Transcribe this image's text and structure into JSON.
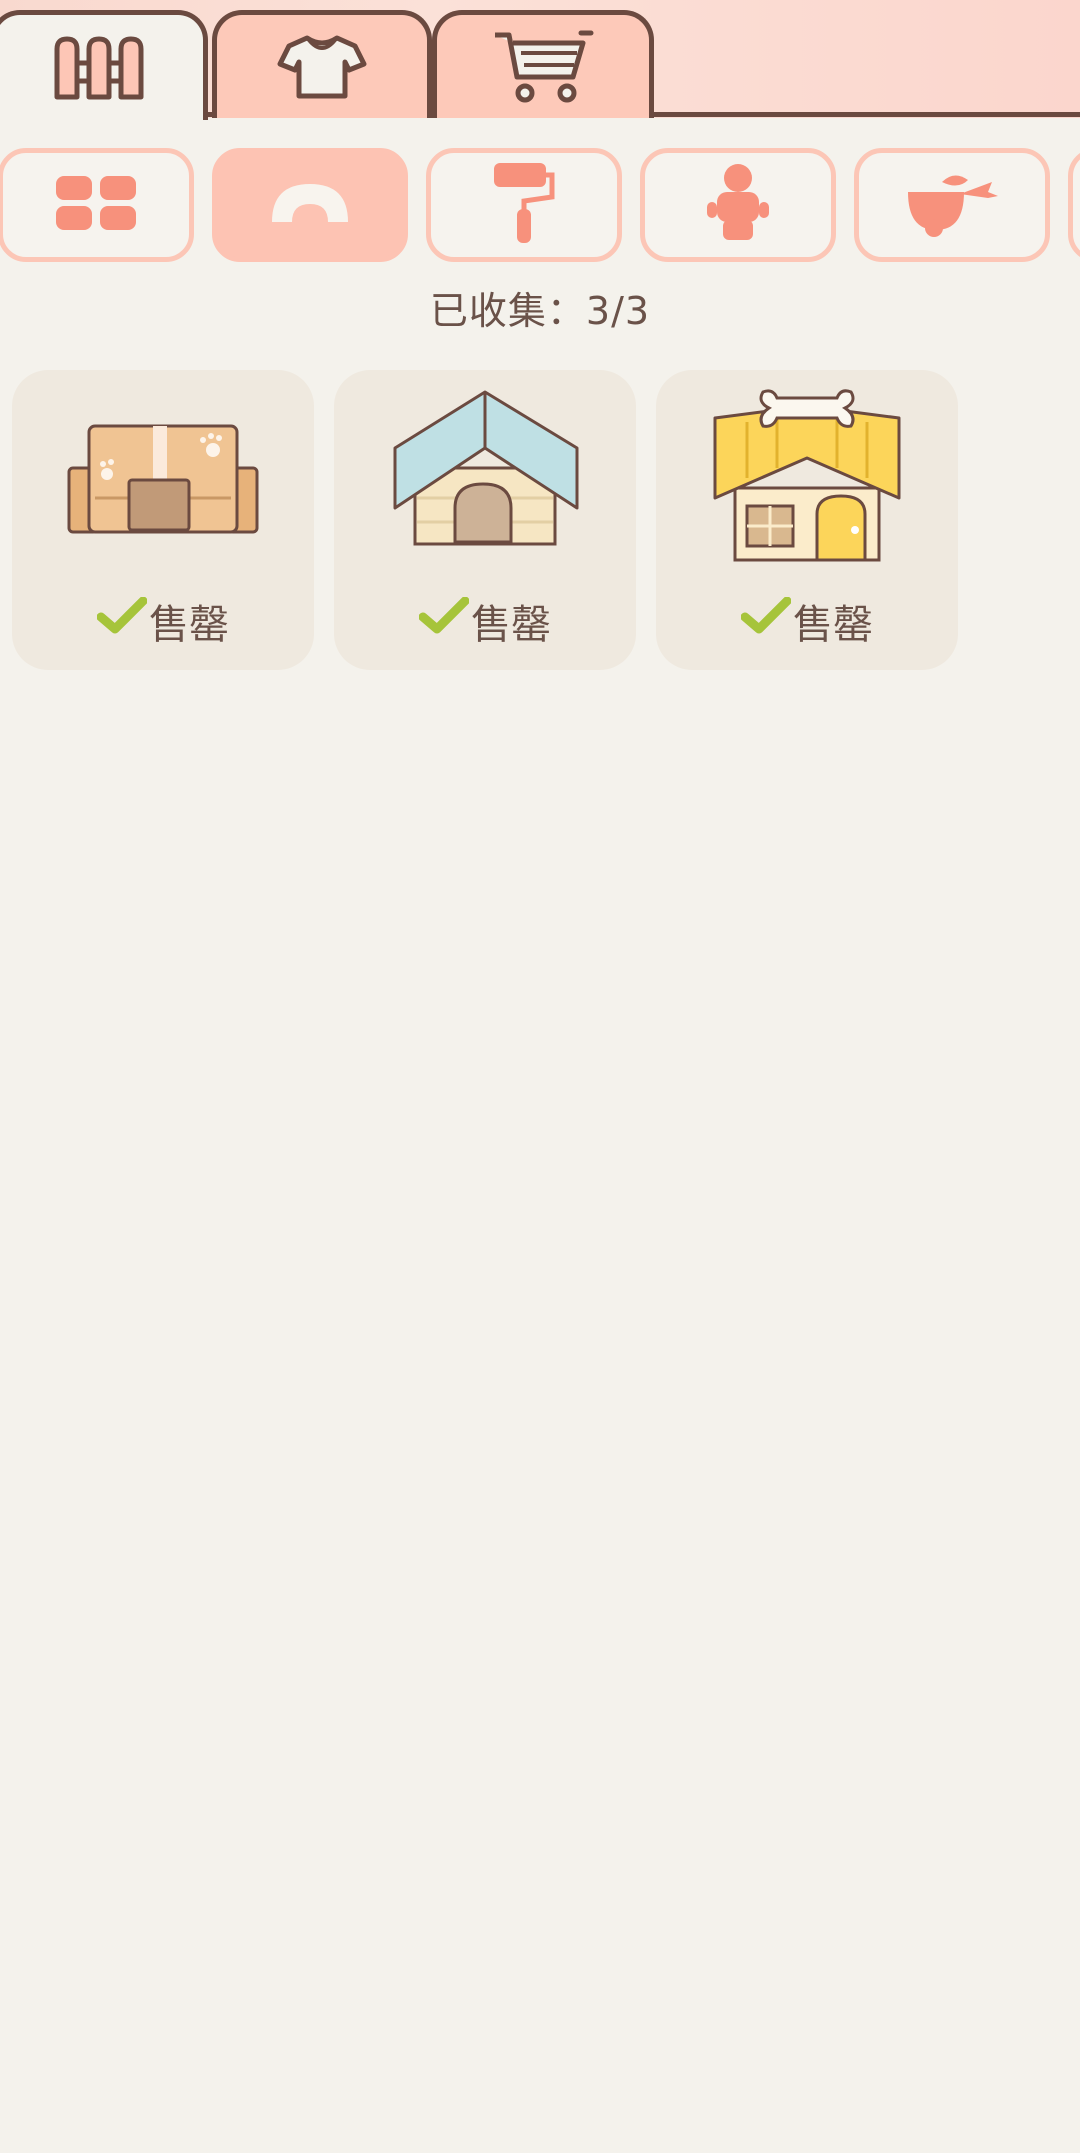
{
  "main_tabs": [
    {
      "name": "furniture",
      "icon": "fence-icon",
      "active": true
    },
    {
      "name": "clothing",
      "icon": "shirt-icon",
      "active": false
    },
    {
      "name": "shop",
      "icon": "shopping-cart-icon",
      "active": false
    }
  ],
  "categories": [
    {
      "icon": "grid-icon",
      "active": false
    },
    {
      "icon": "pet-bed-icon",
      "active": true
    },
    {
      "icon": "paint-roller-icon",
      "active": false
    },
    {
      "icon": "figure-icon",
      "active": false
    },
    {
      "icon": "fish-bowl-icon",
      "active": false
    }
  ],
  "collection": {
    "label": "已收集：3/3"
  },
  "items": [
    {
      "art": "cardboard-box-house-icon",
      "status": "售罄"
    },
    {
      "art": "blue-roof-doghouse-icon",
      "status": "售罄"
    },
    {
      "art": "yellow-bone-doghouse-icon",
      "status": "售罄"
    }
  ],
  "colors": {
    "background": "#f4f2ec",
    "accent": "#fdc3b3",
    "outline": "#6b4a40",
    "card": "#efe9df",
    "check": "#a6c43a",
    "text": "#6a5249"
  }
}
